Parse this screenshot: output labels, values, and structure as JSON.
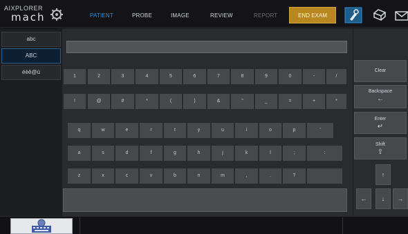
{
  "app": {
    "logo_line1": "AIXPLORER",
    "logo_line2": "mach"
  },
  "tabs": [
    {
      "label": "PATIENT",
      "state": "active"
    },
    {
      "label": "PROBE",
      "state": "normal"
    },
    {
      "label": "IMAGE",
      "state": "normal"
    },
    {
      "label": "REVIEW",
      "state": "normal"
    },
    {
      "label": "REPORT",
      "state": "disabled"
    }
  ],
  "end_exam_label": "END EXAM",
  "keyboard_modes": [
    {
      "label": "abc",
      "selected": false
    },
    {
      "label": "ABC",
      "selected": true
    },
    {
      "label": "éèê@ù",
      "selected": false
    }
  ],
  "text_field": {
    "value": ""
  },
  "rows": {
    "numbers": [
      "1",
      "2",
      "3",
      "4",
      "5",
      "6",
      "7",
      "8",
      "9",
      "0",
      "-",
      "/"
    ],
    "symbols": [
      "!",
      "@",
      "#",
      "*",
      "(",
      ")",
      "&",
      "\"",
      "_",
      "=",
      "+",
      "*"
    ],
    "row_q": [
      "q",
      "w",
      "e",
      "r",
      "t",
      "y",
      "u",
      "i",
      "o",
      "p",
      "'"
    ],
    "row_a": [
      "a",
      "s",
      "d",
      "f",
      "g",
      "h",
      "j",
      "k",
      "l",
      ";",
      ":"
    ],
    "row_z": [
      "z",
      "x",
      "c",
      "v",
      "b",
      "n",
      "m",
      ",",
      ".",
      "?"
    ]
  },
  "side_keys": {
    "clear": "Clear",
    "backspace": "Backspace",
    "backspace_glyph": "←",
    "enter": "Enter",
    "enter_glyph": "↵",
    "shift": "Shift",
    "shift_glyph": "⇧",
    "up": "↑",
    "left": "←",
    "down": "↓",
    "right": "→"
  },
  "colors": {
    "accent": "#2f8fd8",
    "end_exam": "#b8871f"
  }
}
